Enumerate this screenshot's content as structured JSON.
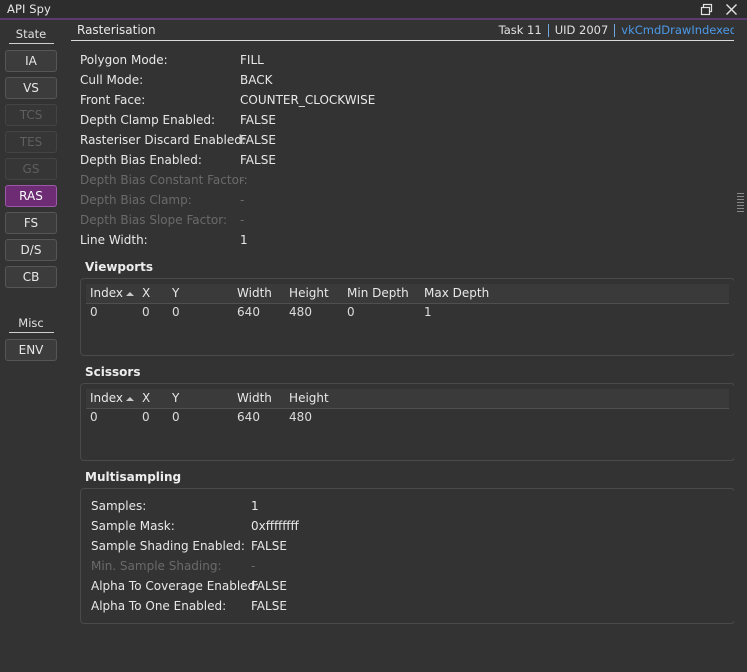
{
  "window": {
    "title": "API Spy",
    "restore_icon": "restore-window-icon",
    "close_icon": "close-icon"
  },
  "sidebar": {
    "groups": [
      {
        "label": "State",
        "items": [
          {
            "label": "IA",
            "state": "enabled"
          },
          {
            "label": "VS",
            "state": "enabled"
          },
          {
            "label": "TCS",
            "state": "disabled"
          },
          {
            "label": "TES",
            "state": "disabled"
          },
          {
            "label": "GS",
            "state": "disabled"
          },
          {
            "label": "RAS",
            "state": "active"
          },
          {
            "label": "FS",
            "state": "enabled"
          },
          {
            "label": "D/S",
            "state": "enabled"
          },
          {
            "label": "CB",
            "state": "enabled"
          }
        ]
      },
      {
        "label": "Misc",
        "items": [
          {
            "label": "ENV",
            "state": "enabled"
          }
        ]
      }
    ]
  },
  "header": {
    "breadcrumb": "Rasterisation",
    "task": "Task 11",
    "uid": "UID 2007",
    "command": "vkCmdDrawIndexed",
    "link_color": "#4c9ae8"
  },
  "rasterisation": {
    "properties": [
      {
        "label": "Polygon Mode:",
        "value": "FILL",
        "dim": false
      },
      {
        "label": "Cull Mode:",
        "value": "BACK",
        "dim": false
      },
      {
        "label": "Front Face:",
        "value": "COUNTER_CLOCKWISE",
        "dim": false
      },
      {
        "label": "Depth Clamp Enabled:",
        "value": "FALSE",
        "dim": false
      },
      {
        "label": "Rasteriser Discard Enabled:",
        "value": "FALSE",
        "dim": false
      },
      {
        "label": "Depth Bias Enabled:",
        "value": "FALSE",
        "dim": false
      },
      {
        "label": "Depth Bias Constant Factor:",
        "value": "-",
        "dim": true
      },
      {
        "label": "Depth Bias Clamp:",
        "value": "-",
        "dim": true
      },
      {
        "label": "Depth Bias Slope Factor:",
        "value": "-",
        "dim": true
      },
      {
        "label": "Line Width:",
        "value": "1",
        "dim": false
      }
    ]
  },
  "viewports": {
    "title": "Viewports",
    "columns": [
      "Index",
      "X",
      "Y",
      "Width",
      "Height",
      "Min Depth",
      "Max Depth"
    ],
    "sorted_column": "Index",
    "sort_direction": "ascending",
    "rows": [
      {
        "index": "0",
        "x": "0",
        "y": "0",
        "width": "640",
        "height": "480",
        "min_depth": "0",
        "max_depth": "1"
      }
    ]
  },
  "scissors": {
    "title": "Scissors",
    "columns": [
      "Index",
      "X",
      "Y",
      "Width",
      "Height"
    ],
    "sorted_column": "Index",
    "sort_direction": "ascending",
    "rows": [
      {
        "index": "0",
        "x": "0",
        "y": "0",
        "width": "640",
        "height": "480"
      }
    ]
  },
  "multisampling": {
    "title": "Multisampling",
    "properties": [
      {
        "label": "Samples:",
        "value": "1",
        "dim": false
      },
      {
        "label": "Sample Mask:",
        "value": "0xffffffff",
        "dim": false
      },
      {
        "label": "Sample Shading Enabled:",
        "value": "FALSE",
        "dim": false
      },
      {
        "label": "Min. Sample Shading:",
        "value": "-",
        "dim": true
      },
      {
        "label": "Alpha To Coverage Enabled:",
        "value": "FALSE",
        "dim": false
      },
      {
        "label": "Alpha To One Enabled:",
        "value": "FALSE",
        "dim": false
      }
    ]
  },
  "scrollbar": {
    "orientation": "vertical",
    "grip_name": "scroll-grip"
  }
}
